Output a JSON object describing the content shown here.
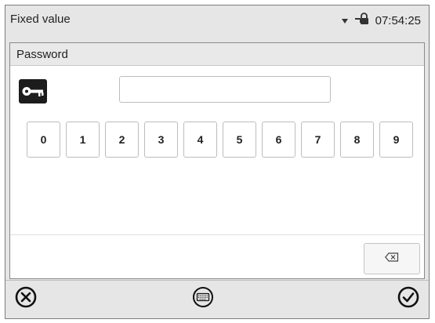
{
  "statusbar": {
    "title": "Fixed value",
    "time": "07:54:25",
    "icons": [
      "dropdown-arrow-icon",
      "network-lock-icon"
    ]
  },
  "dialog": {
    "title": "Password",
    "key_icon": "key-icon",
    "password_value": "",
    "digits": [
      "0",
      "1",
      "2",
      "3",
      "4",
      "5",
      "6",
      "7",
      "8",
      "9"
    ],
    "backspace_icon": "backspace-icon"
  },
  "footer": {
    "cancel_icon": "cancel-icon",
    "keyboard_icon": "keyboard-icon",
    "confirm_icon": "confirm-icon"
  }
}
